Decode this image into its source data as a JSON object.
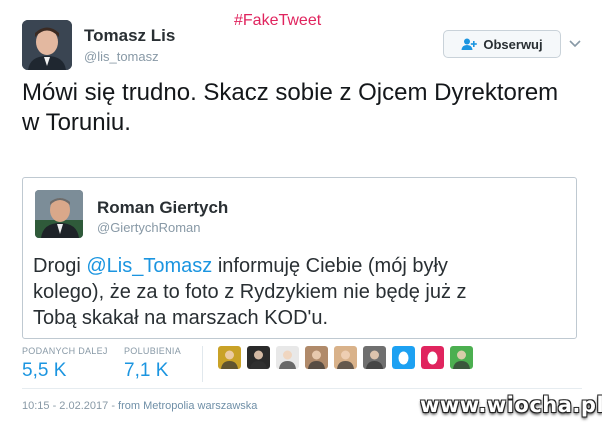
{
  "fake_tag": "#FakeTweet",
  "author": {
    "name": "Tomasz Lis",
    "handle": "@lis_tomasz"
  },
  "follow_button": {
    "label": "Obserwuj"
  },
  "tweet": {
    "line1": "Mówi się trudno. Skacz sobie z Ojcem Dyrektorem",
    "line2": "w Toruniu."
  },
  "quoted": {
    "name": "Roman Giertych",
    "handle": "@GiertychRoman",
    "text_prefix": "Drogi ",
    "mention": "@Lis_Tomasz",
    "text_rest1": " informuję Ciebie (mój były",
    "line2": "kolego), że za to foto z Rydzykiem nie będę już z",
    "line3": "Tobą skakał na marszach KOD'u."
  },
  "stats": {
    "retweets_label": "PODANYCH DALEJ",
    "retweets_value": "5,5 K",
    "likes_label": "POLUBIENIA",
    "likes_value": "7,1 K"
  },
  "likers": [
    {
      "icon": "avatar-cartoon",
      "color": "#c9a227"
    },
    {
      "icon": "avatar-dark",
      "color": "#2a2a2a"
    },
    {
      "icon": "avatar-sketch",
      "color": "#e8e8e8"
    },
    {
      "icon": "avatar-man",
      "color": "#b08a6a"
    },
    {
      "icon": "avatar-woman",
      "color": "#d9b28a"
    },
    {
      "icon": "avatar-photo",
      "color": "#6f6f6f"
    },
    {
      "icon": "default-egg-blue",
      "color": "#1da1f2"
    },
    {
      "icon": "default-egg-pink",
      "color": "#e0245e"
    },
    {
      "icon": "avatar-green-smile",
      "color": "#4caf50"
    }
  ],
  "timestamp": {
    "time": "10:15 - 2.02.2017",
    "source": "from Metropolia warszawska"
  },
  "watermark": "www.wiocha.pl"
}
